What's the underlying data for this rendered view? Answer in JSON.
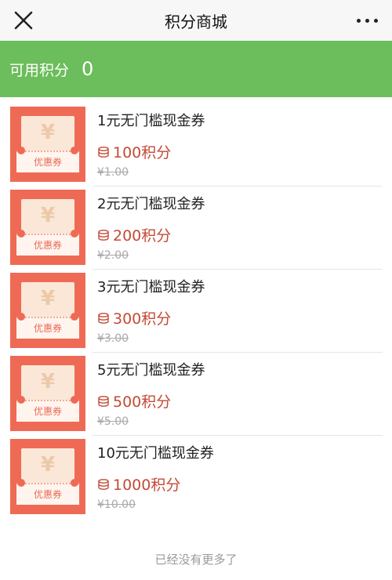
{
  "header": {
    "title": "积分商城",
    "close_icon": "close-icon",
    "more_icon": "more-dots-icon"
  },
  "points": {
    "label": "可用积分",
    "value": "0"
  },
  "items": [
    {
      "name": "1元无门槛现金券",
      "points": "100积分",
      "original": "¥1.00",
      "badge": "优惠券",
      "yen": "¥"
    },
    {
      "name": "2元无门槛现金券",
      "points": "200积分",
      "original": "¥2.00",
      "badge": "优惠券",
      "yen": "¥"
    },
    {
      "name": "3元无门槛现金券",
      "points": "300积分",
      "original": "¥3.00",
      "badge": "优惠券",
      "yen": "¥"
    },
    {
      "name": "5元无门槛现金券",
      "points": "500积分",
      "original": "¥5.00",
      "badge": "优惠券",
      "yen": "¥"
    },
    {
      "name": "10元无门槛现金券",
      "points": "1000积分",
      "original": "¥10.00",
      "badge": "优惠券",
      "yen": "¥"
    }
  ],
  "footer": {
    "text": "已经没有更多了"
  },
  "colors": {
    "header_bg": "#f7f7f7",
    "points_bar": "#6cbd5b",
    "price_red": "#c24b36",
    "coupon_red": "#ef6a55"
  }
}
